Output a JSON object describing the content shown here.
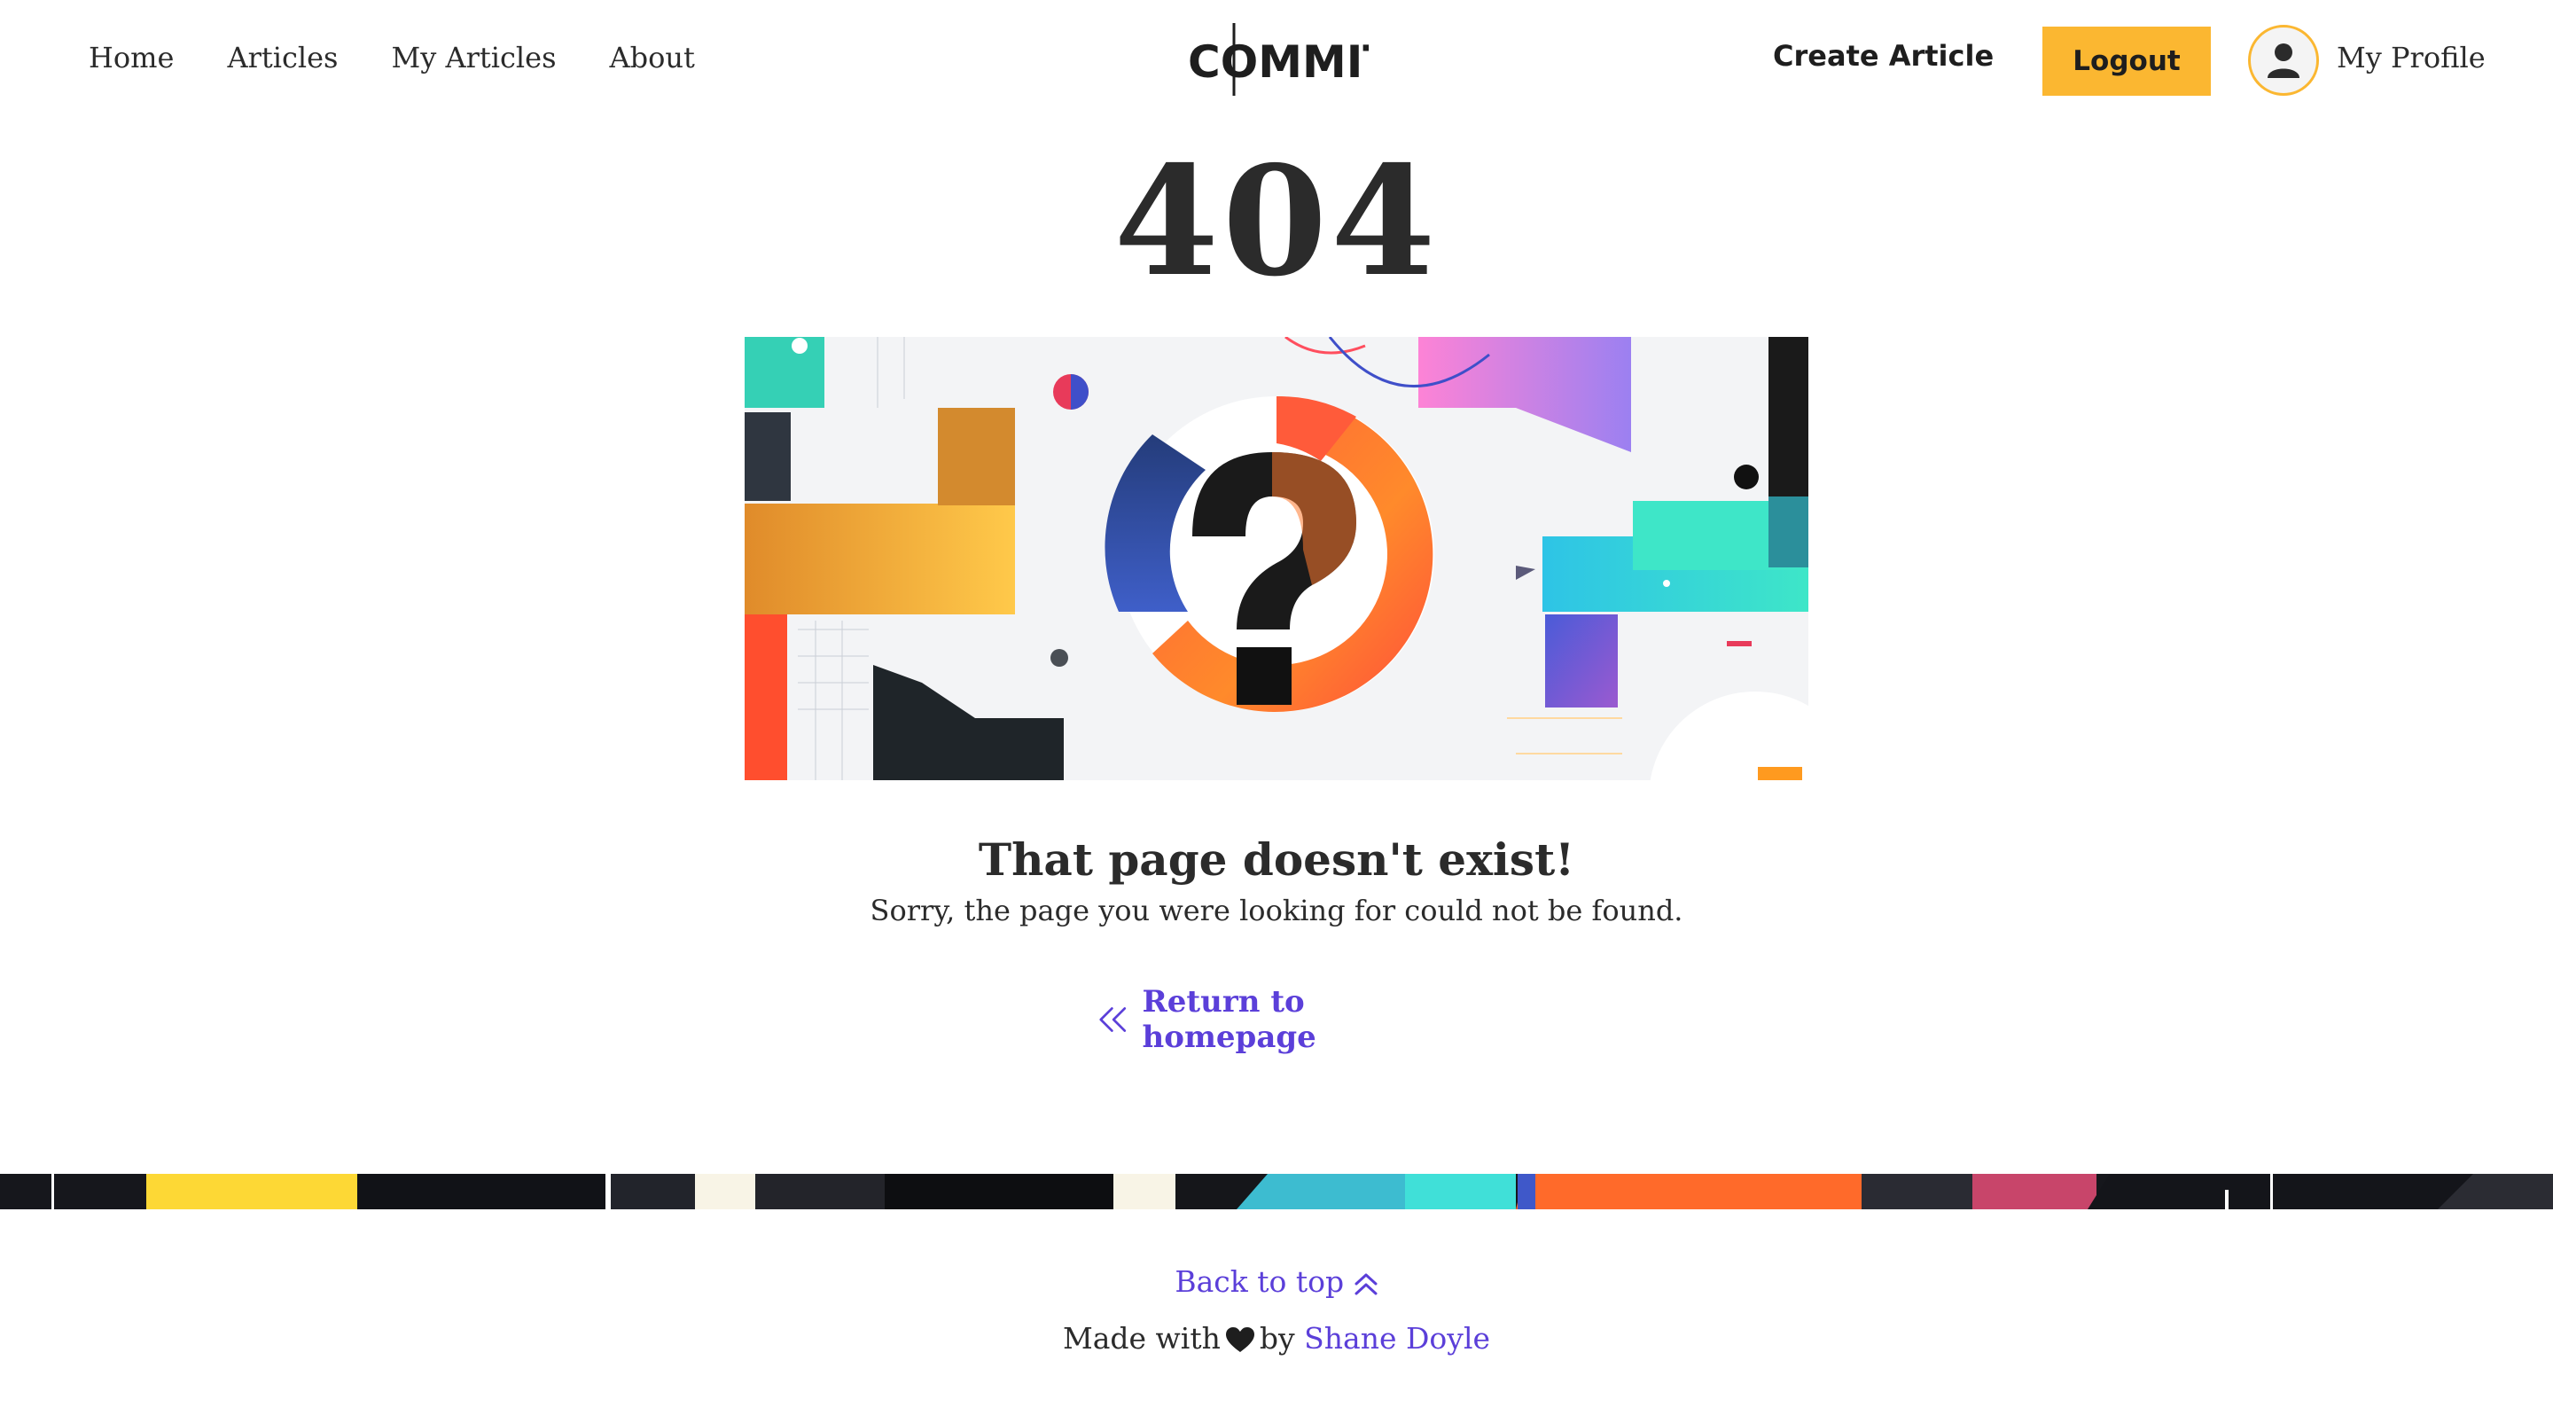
{
  "nav": {
    "links": [
      "Home",
      "Articles",
      "My Articles",
      "About"
    ],
    "logo": "COMMIT",
    "create_article": "Create Article",
    "logout": "Logout",
    "profile": "My Profile"
  },
  "main": {
    "code": "404",
    "title": "That page doesn't exist!",
    "message": "Sorry, the page you were looking for could not be found.",
    "return_link": "Return to homepage"
  },
  "footer": {
    "back_to_top": "Back to top",
    "made_with": "Made with",
    "by": "by",
    "author": "Shane Doyle"
  },
  "colors": {
    "accent": "#fbb731",
    "link": "#5b3fd9",
    "text": "#2b2b2b"
  }
}
